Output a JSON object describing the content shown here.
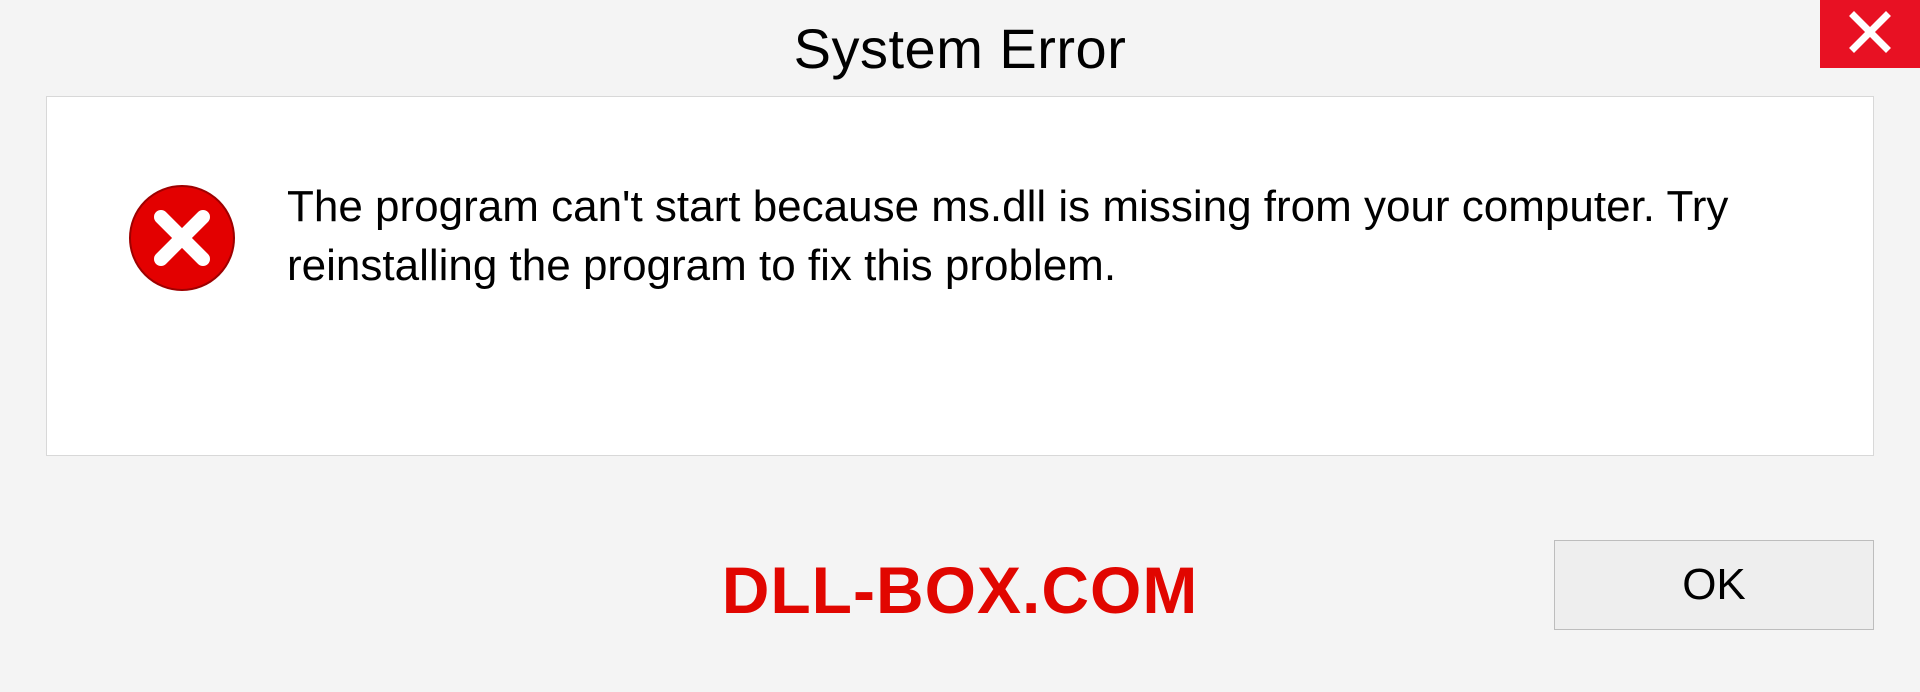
{
  "dialog": {
    "title": "System Error",
    "message": "The program can't start because ms.dll is missing from your computer. Try reinstalling the program to fix this problem.",
    "ok_label": "OK"
  },
  "watermark": {
    "text": "DLL-BOX.COM"
  }
}
